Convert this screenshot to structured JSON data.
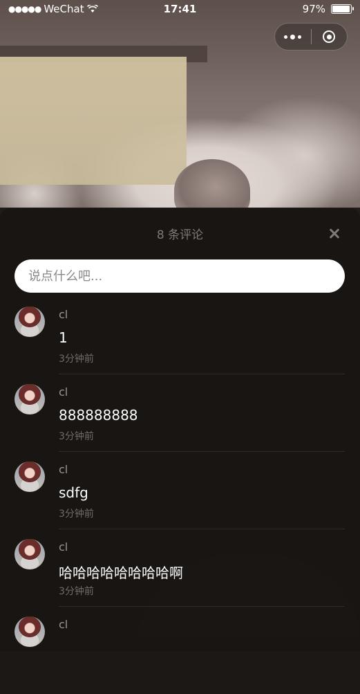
{
  "status_bar": {
    "carrier": "WeChat",
    "time": "17:41",
    "battery": "97%",
    "battery_level": 0.97
  },
  "capsule": {
    "more_icon": "more-dots-icon",
    "close_icon": "target-ring-icon"
  },
  "comments_panel": {
    "title": "8 条评论",
    "input_placeholder": "说点什么吧...",
    "comments": [
      {
        "user": "cl",
        "text": "1",
        "time": "3分钟前"
      },
      {
        "user": "cl",
        "text": "888888888",
        "time": "3分钟前"
      },
      {
        "user": "cl",
        "text": "sdfg",
        "time": "3分钟前"
      },
      {
        "user": "cl",
        "text": "哈哈哈哈哈哈哈哈啊",
        "time": "3分钟前"
      },
      {
        "user": "cl",
        "text": "",
        "time": ""
      }
    ]
  }
}
